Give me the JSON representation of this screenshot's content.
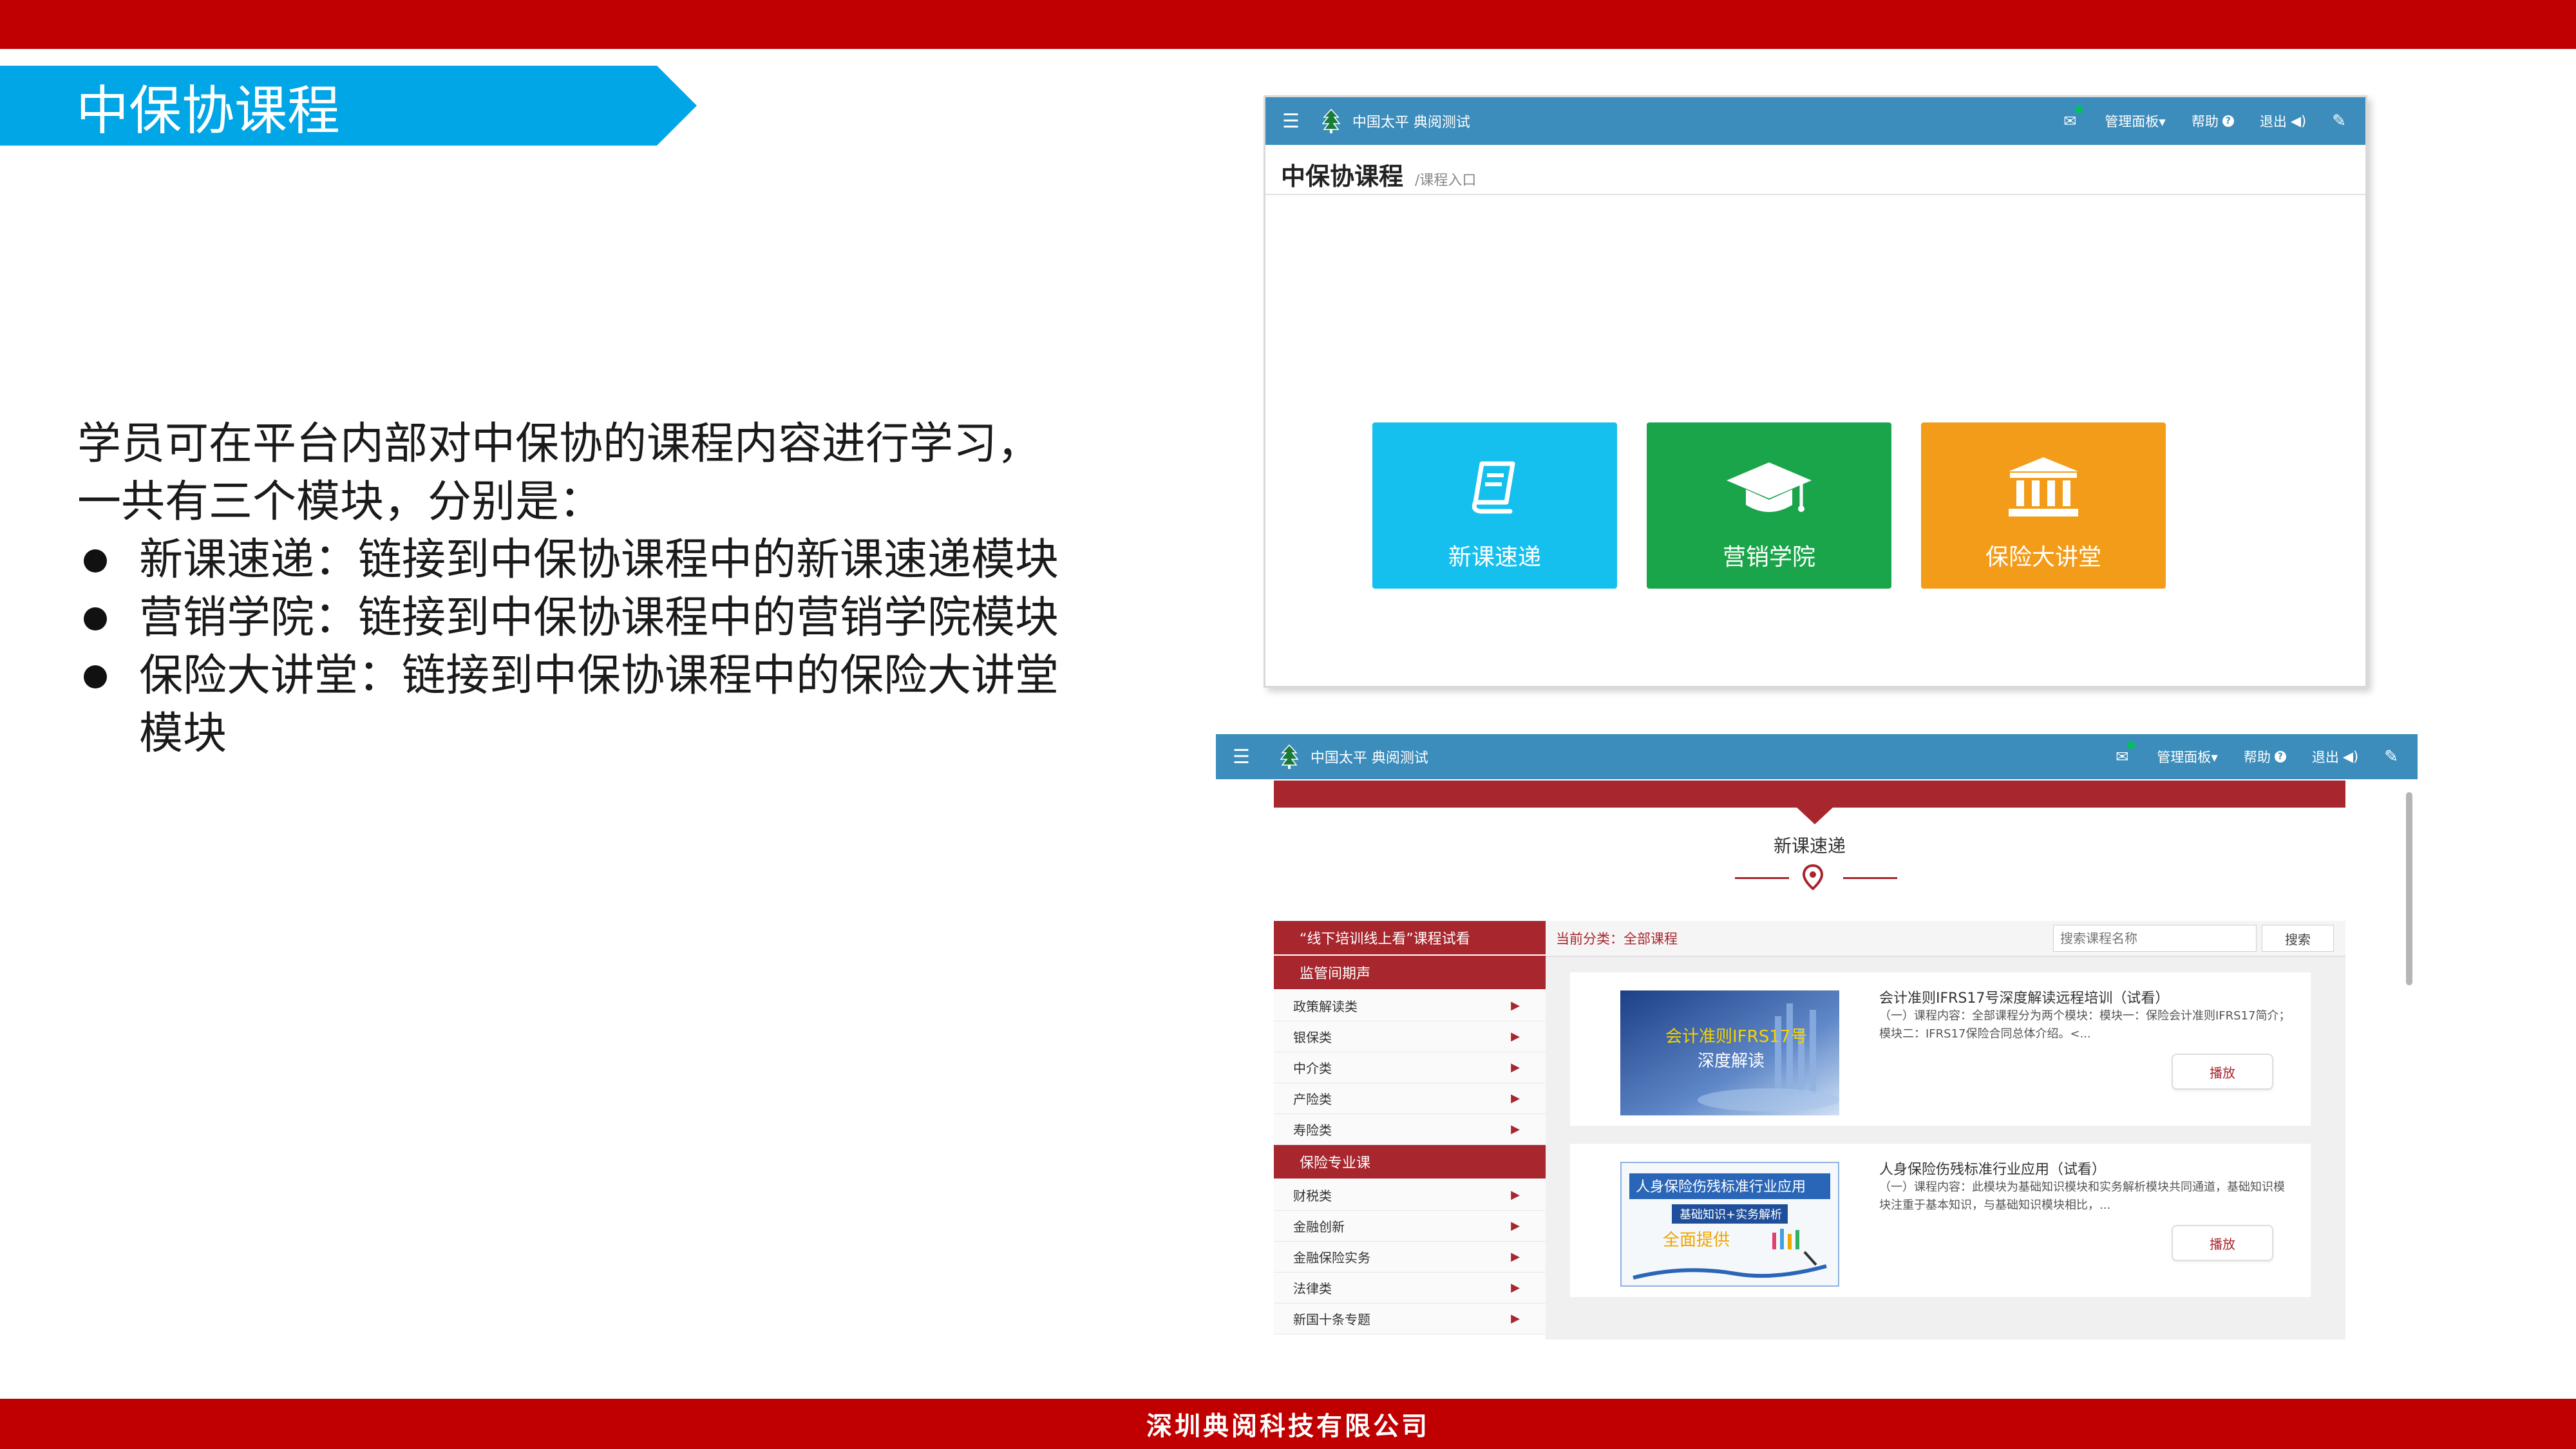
{
  "slide": {
    "title": "中保协课程",
    "intro": "学员可在平台内部对中保协的课程内容进行学习，一共有三个模块，分别是：",
    "bullets": [
      "新课速递：链接到中保协课程中的新课速递模块",
      "营销学院：链接到中保协课程中的营销学院模块",
      "保险大讲堂：链接到中保协课程中的保险大讲堂模块"
    ],
    "footer": "深圳典阅科技有限公司"
  },
  "navbar": {
    "brand": "中国太平 典阅测试",
    "manage_label": "管理面板▾",
    "help_label": "帮助",
    "logout_label": "退出",
    "menu_icon": "hamburger-icon",
    "mail_icon": "mail-icon",
    "pen_icon": "pen-icon"
  },
  "screen1": {
    "heading": "中保协课程",
    "subheading": "/课程入口",
    "tiles": [
      {
        "label": "新课速递",
        "icon": "book-icon",
        "color": "#15c0ee"
      },
      {
        "label": "营销学院",
        "icon": "graduation-cap-icon",
        "color": "#1aa54a"
      },
      {
        "label": "保险大讲堂",
        "icon": "institution-icon",
        "color": "#f29c1a"
      }
    ]
  },
  "screen2": {
    "section_title": "新课速递",
    "sidebar": {
      "groups": [
        {
          "title": "“线下培训线上看”课程试看",
          "items": []
        },
        {
          "title": "监管间期声",
          "items": [
            "政策解读类",
            "银保类",
            "中介类",
            "产险类",
            "寿险类"
          ]
        },
        {
          "title": "保险专业课",
          "items": [
            "财税类",
            "金融创新",
            "金融保险实务",
            "法律类",
            "新国十条专题"
          ]
        }
      ]
    },
    "category_label": "当前分类：全部课程",
    "search_placeholder": "搜索课程名称",
    "search_button": "搜索",
    "courses": [
      {
        "title": "会计准则IFRS17号深度解读远程培训（试看）",
        "desc": "（一）课程内容：全部课程分为两个模块：模块一：保险会计准则IFRS17简介；模块二：IFRS17保险合同总体介绍。<...",
        "thumb_text_1": "会计准则IFRS17号",
        "thumb_text_2": "深度解读",
        "play": "播放"
      },
      {
        "title": "人身保险伤残标准行业应用（试看）",
        "desc": "（一）课程内容：此模块为基础知识模块和实务解析模块共同通道，基础知识模块注重于基本知识，与基础知识模块相比，...",
        "thumb_text_1": "人身保险伤残标准行业应用",
        "thumb_text_2": "基础知识+实务解析",
        "thumb_text_3": "全面提供",
        "play": "播放"
      }
    ]
  },
  "colors": {
    "brand_red": "#c00000",
    "banner_blue": "#00a6e6",
    "navbar_blue": "#3c8dbc",
    "accent_red": "#a8262d"
  }
}
